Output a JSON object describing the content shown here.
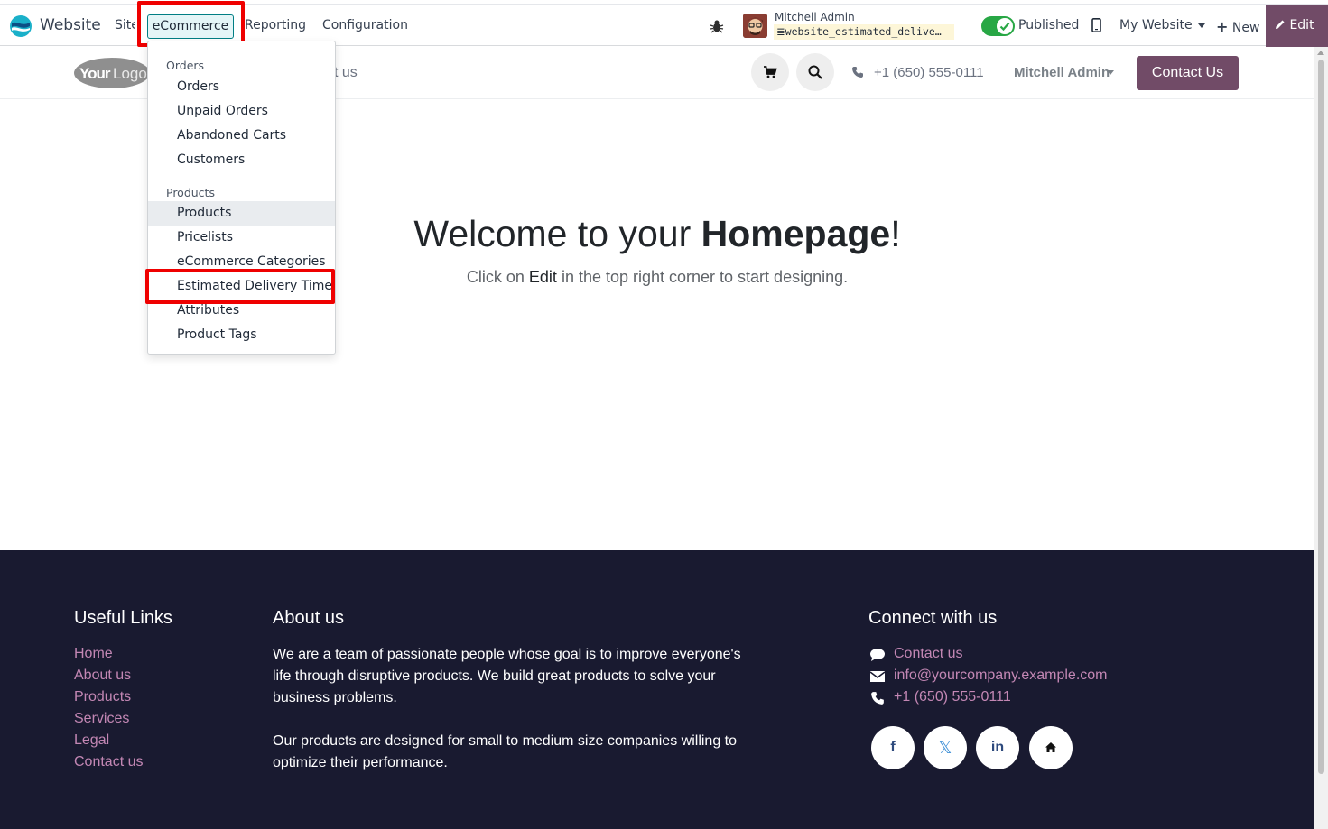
{
  "topbar": {
    "app_name": "Website",
    "menus": {
      "site": "Site",
      "ecommerce": "eCommerce",
      "reporting": "Reporting",
      "configuration": "Configuration"
    },
    "user_name": "Mitchell Admin",
    "db_name": "website_estimated_delive…",
    "published_label": "Published",
    "my_website_label": "My Website",
    "new_label": "New",
    "edit_label": "Edit",
    "accent_color": "#714b67",
    "published": true
  },
  "dropdown": {
    "orders_header": "Orders",
    "orders_items": [
      "Orders",
      "Unpaid Orders",
      "Abandoned Carts",
      "Customers"
    ],
    "products_header": "Products",
    "products_items": [
      "Products",
      "Pricelists",
      "eCommerce Categories",
      "Estimated Delivery Time",
      "Attributes",
      "Product Tags"
    ],
    "highlighted_item": "Estimated Delivery Time"
  },
  "site_header": {
    "logo_text": "YourLogo",
    "nav_fragment": "t us",
    "phone": "+1 (650) 555-0111",
    "user": "Mitchell Admin",
    "contact_btn": "Contact Us"
  },
  "hero": {
    "title_pre": "Welcome to your ",
    "title_bold": "Homepage",
    "title_post": "!",
    "sub_pre": "Click on ",
    "sub_bold": "Edit",
    "sub_post": " in the top right corner to start designing."
  },
  "footer": {
    "useful_links_title": "Useful Links",
    "useful_links": [
      "Home",
      "About us",
      "Products",
      "Services",
      "Legal",
      "Contact us"
    ],
    "about_title": "About us",
    "about_p1": "We are a team of passionate people whose goal is to improve everyone's life through disruptive products. We build great products to solve your business problems.",
    "about_p2": "Our products are designed for small to medium size companies willing to optimize their performance.",
    "connect_title": "Connect with us",
    "contact_link": "Contact us",
    "email": "info@yourcompany.example.com",
    "phone": "+1 (650) 555-0111",
    "social_icons": [
      "facebook-icon",
      "x-twitter-icon",
      "linkedin-icon",
      "home-icon"
    ]
  }
}
